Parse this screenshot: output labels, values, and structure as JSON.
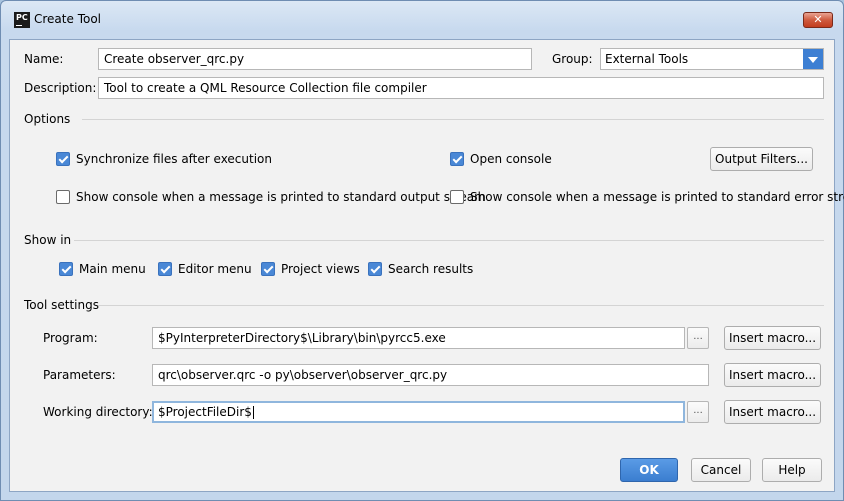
{
  "window": {
    "title": "Create Tool",
    "app_icon_text": "PC",
    "close_glyph": "✕"
  },
  "form": {
    "name_label": "Name:",
    "name_value": "Create observer_qrc.py",
    "group_label": "Group:",
    "group_value": "External Tools",
    "description_label": "Description:",
    "description_value": "Tool to create a QML Resource Collection file compiler"
  },
  "options": {
    "title": "Options",
    "sync_files": {
      "label": "Synchronize files after execution",
      "checked": true
    },
    "open_console": {
      "label": "Open console",
      "checked": true
    },
    "output_filters_button": "Output Filters...",
    "show_console_stdout": {
      "label": "Show console when a message is printed to standard output stream",
      "checked": false
    },
    "show_console_stderr": {
      "label": "Show console when a message is printed to standard error stream",
      "checked": false
    }
  },
  "show_in": {
    "title": "Show in",
    "items": [
      {
        "label": "Main menu",
        "checked": true
      },
      {
        "label": "Editor menu",
        "checked": true
      },
      {
        "label": "Project views",
        "checked": true
      },
      {
        "label": "Search results",
        "checked": true
      }
    ]
  },
  "tool_settings": {
    "title": "Tool settings",
    "program_label": "Program:",
    "program_value": "$PyInterpreterDirectory$\\Library\\bin\\pyrcc5.exe",
    "parameters_label": "Parameters:",
    "parameters_value": "qrc\\observer.qrc -o py\\observer\\observer_qrc.py",
    "working_dir_label": "Working directory:",
    "working_dir_value": "$ProjectFileDir$",
    "browse_glyph": "...",
    "insert_macro_label": "Insert macro..."
  },
  "footer": {
    "ok_label": "OK",
    "cancel_label": "Cancel",
    "help_label": "Help"
  },
  "colors": {
    "accent": "#4a88d6",
    "primary_button": "#3b7ed0",
    "frame": "#c3d6ec"
  }
}
